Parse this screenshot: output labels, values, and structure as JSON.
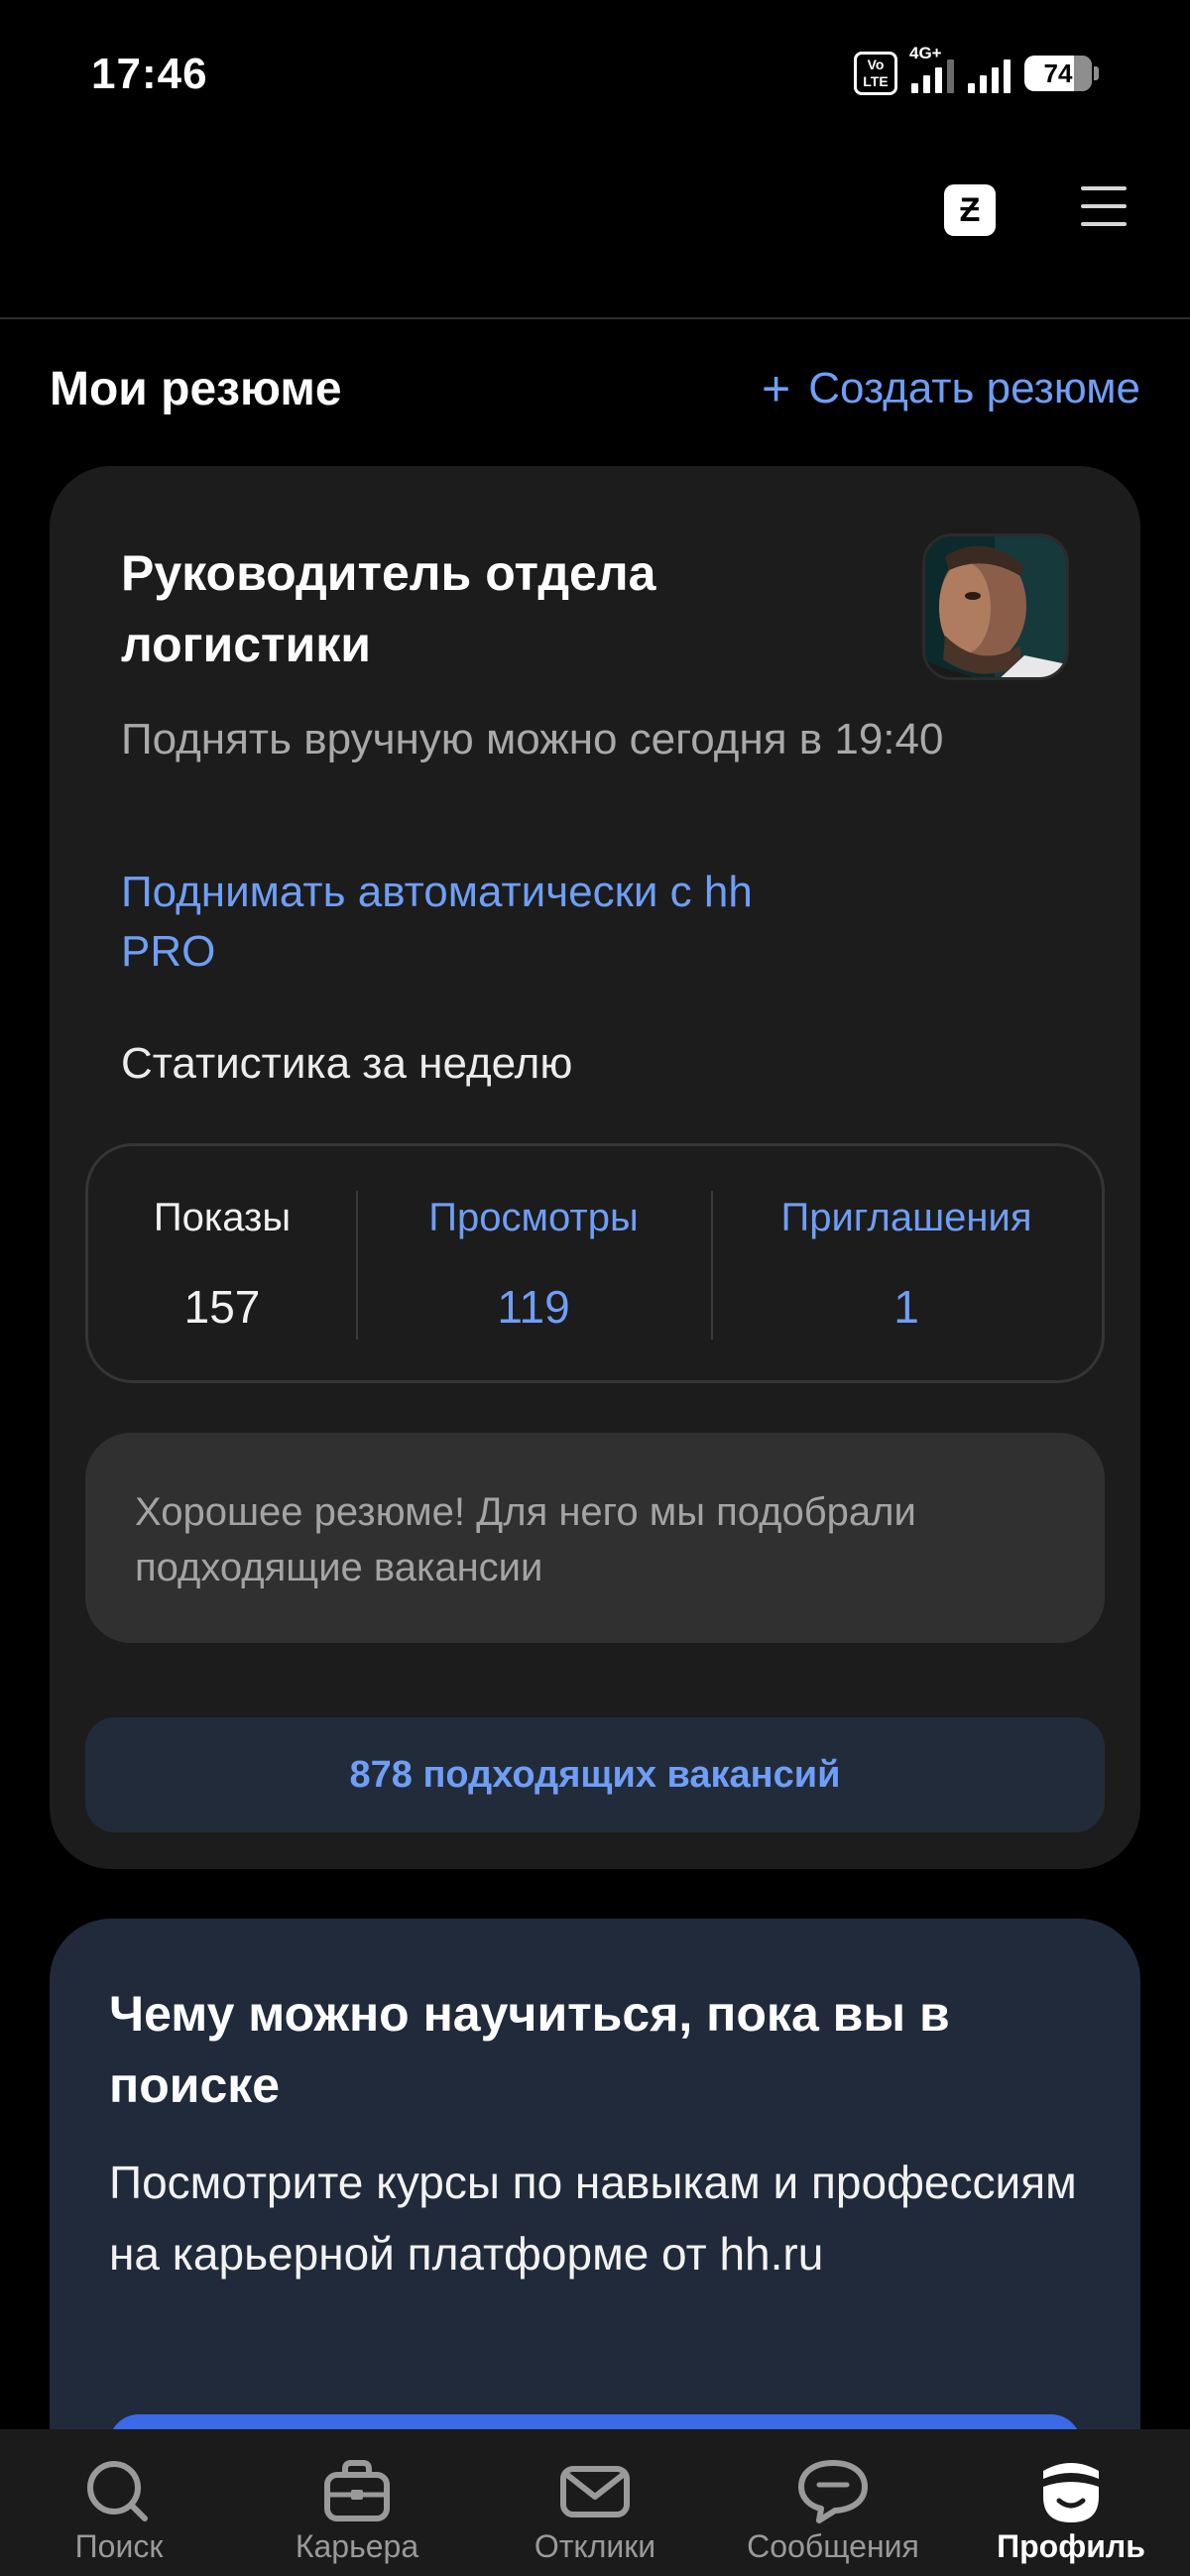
{
  "status_bar": {
    "time": "17:46",
    "volte_label": "Vo LTE",
    "network_label": "4G+",
    "battery_level": "74"
  },
  "top_bar": {
    "logo_glyph": "Ƶ"
  },
  "section": {
    "title": "Мои резюме",
    "create_label": "Создать резюме"
  },
  "resume": {
    "title": "Руководитель отдела логистики",
    "raise_text": "Поднять вручную можно сегодня в 19:40",
    "auto_link": "Поднимать автоматически с hh PRO",
    "stats_label": "Статистика за неделю",
    "stats": [
      {
        "label": "Показы",
        "value": "157"
      },
      {
        "label": "Просмотры",
        "value": "119"
      },
      {
        "label": "Приглашения",
        "value": "1"
      }
    ],
    "tip": "Хорошее резюме! Для него мы подобрали подходящие вакансии",
    "vacancies_button": "878 подходящих вакансий"
  },
  "learn": {
    "title": "Чему можно научиться, пока вы в поиске",
    "text": "Посмотрите курсы по навыкам и профессиям на карьерной платформе от hh.ru"
  },
  "bottom_nav": {
    "items": [
      {
        "label": "Поиск",
        "icon": "search-icon"
      },
      {
        "label": "Карьера",
        "icon": "briefcase-icon"
      },
      {
        "label": "Отклики",
        "icon": "mail-icon"
      },
      {
        "label": "Сообщения",
        "icon": "chat-icon"
      },
      {
        "label": "Профиль",
        "icon": "profile-icon"
      }
    ],
    "active_index": 4
  },
  "colors": {
    "accent": "#6f9ef6",
    "background": "#000000",
    "card": "#1c1c1c",
    "learn_card": "#212a3a",
    "button_blue": "#3a6ae8"
  }
}
